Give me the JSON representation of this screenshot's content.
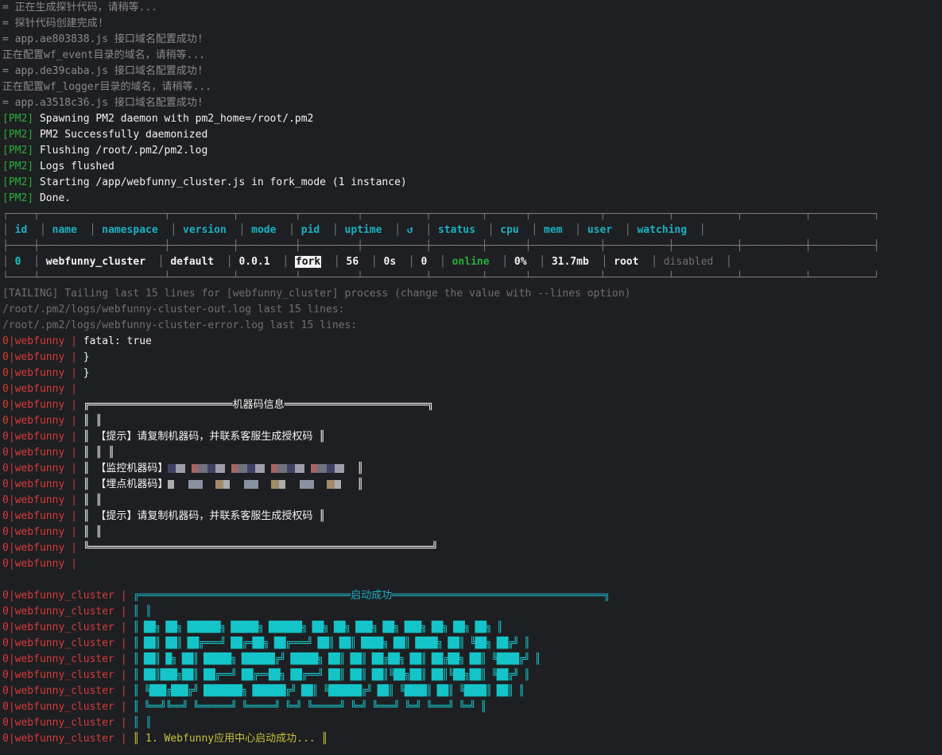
{
  "log_lines": [
    "= 正在生成探针代码，请稍等...",
    "= 探针代码创建完成!",
    "= app.ae803838.js 接口域名配置成功!",
    "正在配置wf_event目录的域名，请稍等...",
    "= app.de39caba.js 接口域名配置成功!",
    "正在配置wf_logger目录的域名，请稍等...",
    "= app.a3518c36.js 接口域名配置成功!"
  ],
  "pm2_prefix": "[PM2]",
  "pm2_lines": [
    "Spawning PM2 daemon with pm2_home=/root/.pm2",
    "PM2 Successfully daemonized",
    "Flushing /root/.pm2/pm2.log",
    "Logs flushed",
    "Starting /app/webfunny_cluster.js in fork_mode (1 instance)",
    "Done."
  ],
  "table": {
    "headers": [
      "id",
      "name",
      "namespace",
      "version",
      "mode",
      "pid",
      "uptime",
      "↺",
      "status",
      "cpu",
      "mem",
      "user",
      "watching"
    ],
    "row": [
      "0",
      "webfunny_cluster",
      "default",
      "0.0.1",
      "fork",
      "56",
      "0s",
      "0",
      "online",
      "0%",
      "31.7mb",
      "root",
      "disabled"
    ]
  },
  "tail": {
    "tailing": "[TAILING] Tailing last 15 lines for [webfunny_cluster] process (change the value with --lines option)",
    "out_log": "/root/.pm2/logs/webfunny-cluster-out.log last 15 lines:",
    "err_log": "/root/.pm2/logs/webfunny-cluster-error.log last 15 lines:"
  },
  "webfunny": {
    "prefix": "0|webfunny",
    "sep": " | ",
    "lines": [
      "fatal: true",
      "}",
      "}",
      "",
      "╔═══════════════════════机器码信息═══════════════════════╗",
      "║ ║",
      "║ 【提示】请复制机器码，并联系客服生成授权码 ║",
      "║ ║ ║",
      "║ 【监控机器码】",
      "║ 【埋点机器码】",
      "║ ║",
      "║ 【提示】请复制机器码，并联系客服生成授权码 ║",
      "║ ║",
      "╚═══════════════════════════════════════════════════════╝",
      ""
    ]
  },
  "cluster": {
    "prefix": "0|webfunny_cluster",
    "sep": " | ",
    "lines": [
      "╔══════════════════════════════════启动成功══════════════════════════════════╗",
      "║ ║",
      "║ ██╗ ██╗ ██████╗ █████╗ ██████╗ ██╗ ██╗ ███╗ ██╗ ███╗ ██╗ ██╗ ██╗ ║",
      "║ ██║ ██║ ██╔═══╝ ██╔═██╗ ██╔═══╝ ██║ ██║ ████╗ ██║ ████╗ ██║ ╚██╗ ██╔╝ ║",
      "║ ██║ █╗ ██║ █████╗ ██████╔╝ █████╗ ██║ ██║ ██╔██╗ ██║ ██╔██╗ ██║ ╚████╔╝ ║",
      "║ ██║███╗██║ ██╔══╝ ██╔══██╗ ██╔══╝ ██║ ██║ ██║╚██╗██║ ██║╚██╗██║ ╚██╔╝ ║",
      "║ ╚███╔███╔╝ ███████╗ ██████╔╝ ██║ ╚██████╔╝ ██║ ╚████║ ██║ ╚████║ ██║ ║",
      "║ ╚══╝╚══╝ ╚══════╝ ╚═════╝ ╚═╝ ╚═════╝ ╚═╝ ╚═══╝ ╚═╝ ╚═══╝ ╚═╝ ║",
      "║ ║",
      "║ 1. Webfunny应用中心启动成功... ║"
    ]
  }
}
